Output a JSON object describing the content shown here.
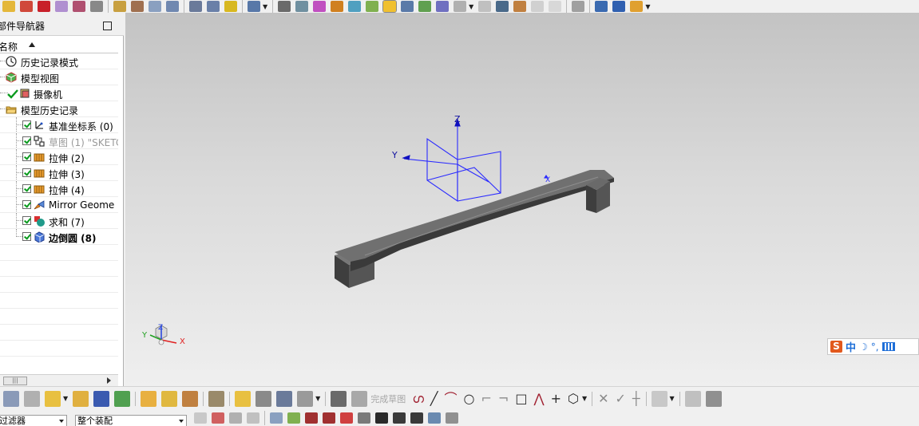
{
  "navigator": {
    "title": "部件导航器",
    "column_name": "名称",
    "items": [
      {
        "label": "历史记录模式",
        "icon": "clock-icon",
        "kind": "root"
      },
      {
        "label": "模型视图",
        "icon": "model-views-icon",
        "kind": "root"
      },
      {
        "label": "摄像机",
        "icon": "camera-icon",
        "kind": "camera"
      },
      {
        "label": "模型历史记录",
        "icon": "folder-open-icon",
        "kind": "root"
      },
      {
        "label": "基准坐标系 (0)",
        "icon": "datum-csys-icon",
        "kind": "feature"
      },
      {
        "label": "草图 (1) \"SKETC",
        "icon": "sketch-icon",
        "kind": "feature",
        "dimmed": true
      },
      {
        "label": "拉伸 (2)",
        "icon": "extrude-icon",
        "kind": "feature"
      },
      {
        "label": "拉伸 (3)",
        "icon": "extrude-icon",
        "kind": "feature"
      },
      {
        "label": "拉伸 (4)",
        "icon": "extrude-icon",
        "kind": "feature"
      },
      {
        "label": "Mirror Geome",
        "icon": "mirror-icon",
        "kind": "feature"
      },
      {
        "label": "求和 (7)",
        "icon": "unite-icon",
        "kind": "feature"
      },
      {
        "label": "边倒圆 (8)",
        "icon": "edge-blend-icon",
        "kind": "feature",
        "bold": true
      }
    ],
    "scroll_thumb": "|||"
  },
  "viewport": {
    "csys_labels": {
      "x": "X",
      "y": "Y",
      "z": "Z"
    },
    "triad_labels": {
      "x": "X",
      "y": "Y",
      "z": "Z"
    },
    "colors": {
      "csys": "#2b2bff",
      "part": "#5a5a5a",
      "triad_x": "#e02020",
      "triad_y": "#20a020",
      "triad_z": "#2040e0"
    }
  },
  "toolbar_sketch": {
    "finish_sketch": "完成草图"
  },
  "selection_bar": {
    "type_filter": "过滤器",
    "scope": "整个装配"
  },
  "ime": {
    "logo": "S",
    "mode": "中",
    "moon": "☽",
    "punct": "°,"
  }
}
